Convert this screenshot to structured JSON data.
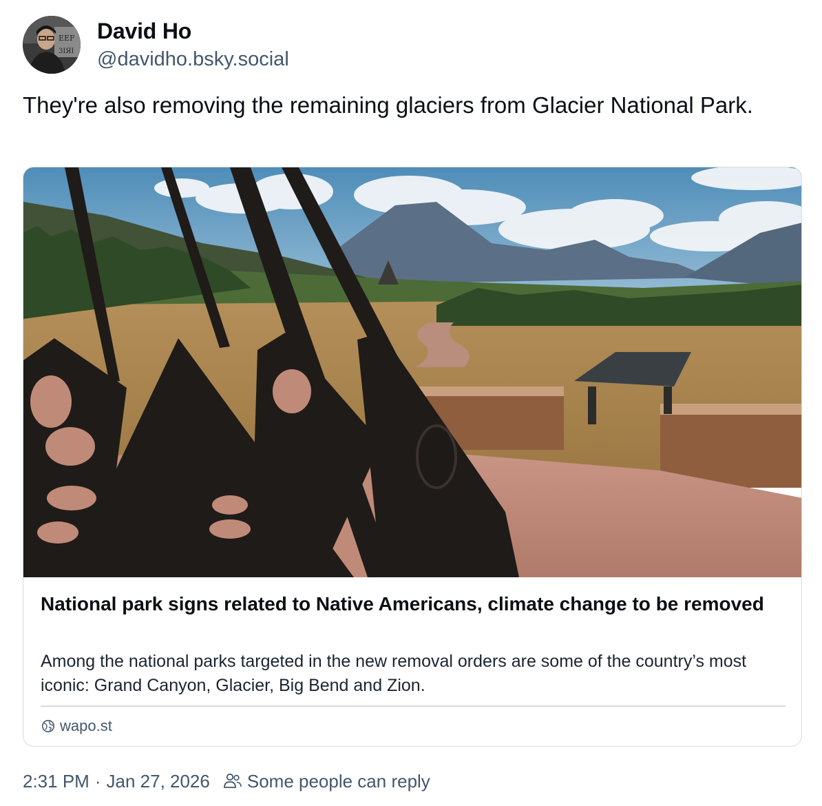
{
  "author": {
    "name": "David Ho",
    "handle": "@davidho.bsky.social"
  },
  "post": {
    "text": "They're also removing the remaining glaciers from Glacier National Park."
  },
  "link_card": {
    "title": "National park signs related to Native Americans, climate change to be removed",
    "description": "Among the national parks targeted in the new removal orders are some of the country’s most iconic: Grand Canyon, Glacier, Big Bend and Zion.",
    "domain": "wapo.st",
    "domain_icon": "globe-icon"
  },
  "footer": {
    "time": "2:31 PM",
    "separator": "·",
    "date": "Jan 27, 2026",
    "reply_icon": "people-icon",
    "reply_setting": "Some people can reply"
  },
  "colors": {
    "text_primary": "#0b0f14",
    "text_secondary": "#42576c",
    "border": "#d4dbe2"
  }
}
